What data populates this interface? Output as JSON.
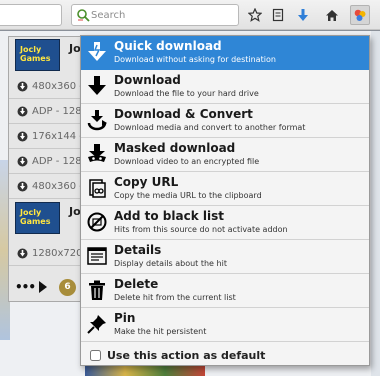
{
  "toolbar": {
    "search_placeholder": "Search",
    "buttons": [
      {
        "name": "bookmark-star-icon"
      },
      {
        "name": "reading-list-icon"
      },
      {
        "name": "downloads-arrow-icon"
      },
      {
        "name": "home-icon"
      },
      {
        "name": "video-downloadhelper-icon"
      }
    ]
  },
  "hits": {
    "thumb_text": "Jocly\nGames",
    "thumb_title": "Jo",
    "rows": [
      {
        "label": "480x360 -"
      },
      {
        "label": "ADP - 128"
      },
      {
        "label": "176x144 -"
      },
      {
        "label": "ADP - 128"
      },
      {
        "label": "480x360 -"
      },
      {
        "label": "1280x720"
      }
    ],
    "more_label": "•••",
    "count": "6"
  },
  "menu": {
    "items": [
      {
        "id": "quick-download",
        "title": "Quick download",
        "desc": "Download without asking for destination",
        "icon": "quick-download-icon",
        "selected": true
      },
      {
        "id": "download",
        "title": "Download",
        "desc": "Download the file to your hard drive",
        "icon": "download-arrow-icon",
        "selected": false
      },
      {
        "id": "download-convert",
        "title": "Download & Convert",
        "desc": "Download media and convert to another format",
        "icon": "convert-icon",
        "selected": false
      },
      {
        "id": "masked-download",
        "title": "Masked download",
        "desc": "Download video to an encrypted file",
        "icon": "masked-download-icon",
        "selected": false
      },
      {
        "id": "copy-url",
        "title": "Copy URL",
        "desc": "Copy the media URL to the clipboard",
        "icon": "copy-link-icon",
        "selected": false
      },
      {
        "id": "blacklist",
        "title": "Add to black list",
        "desc": "Hits from this source do not activate addon",
        "icon": "blacklist-icon",
        "selected": false
      },
      {
        "id": "details",
        "title": "Details",
        "desc": "Display details about the hit",
        "icon": "details-icon",
        "selected": false
      },
      {
        "id": "delete",
        "title": "Delete",
        "desc": "Delete hit from the current list",
        "icon": "trash-icon",
        "selected": false
      },
      {
        "id": "pin",
        "title": "Pin",
        "desc": "Make the hit persistent",
        "icon": "pin-icon",
        "selected": false
      }
    ],
    "default_checkbox_label": "Use this action as default",
    "default_checked": false
  },
  "colors": {
    "selected_bg": "#2f86d6",
    "menu_bg": "#f4f4f4",
    "badge": "#a88d3a"
  }
}
